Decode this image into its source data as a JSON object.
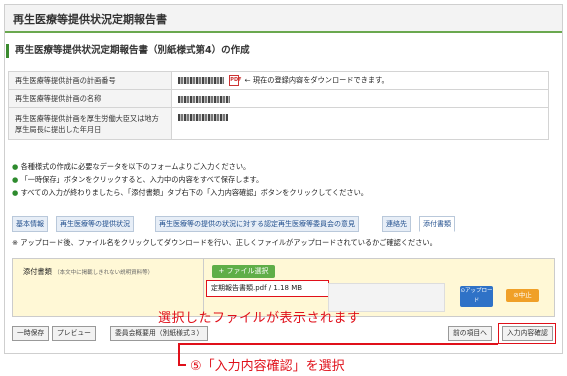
{
  "page": {
    "title": "再生医療等提供状況定期報告書",
    "section_title": "再生医療等提供状況定期報告書（別紙様式第4）の作成"
  },
  "info_table": [
    {
      "label": "再生医療等提供計画の計画番号",
      "note": "← 現在の登録内容をダウンロードできます。"
    },
    {
      "label": "再生医療等提供計画の名称",
      "note": ""
    },
    {
      "label": "再生医療等提供計画を厚生労働大臣又は地方厚生局長に提出した年月日",
      "note": ""
    }
  ],
  "notes": [
    "各種様式の作成に必要なデータを以下のフォームよりご入力ください。",
    "「一時保存」ボタンをクリックすると、入力中の内容をすべて保存します。",
    "すべての入力が終わりましたら、「添付書類」タブ右下の「入力内容確認」ボタンをクリックしてください。"
  ],
  "tabs": [
    "基本情報",
    "再生医療等の提供状況",
    "再生医療等の提供の状況に対する認定再生医療等委員会の意見",
    "連絡先",
    "添付書類"
  ],
  "upload_note": "※ アップロード後、ファイル名をクリックしてダウンロードを行い、正しくファイルがアップロードされているかご確認ください。",
  "attachment": {
    "label": "添付書類",
    "sublabel": "（本文中に掲載しきれない説明資料等）",
    "file_select_label": "+ ファイル選択",
    "file_name": "定期報告書類.pdf / 1.18 MB",
    "upload_label": "アップロード",
    "cancel_label": "中止"
  },
  "bottom_buttons": {
    "save": "一時保存",
    "preview": "プレビュー",
    "committee": "委員会概要用（別紙様式３）",
    "prev": "前の項目へ",
    "confirm": "入力内容確認"
  },
  "annotations": {
    "file_shown": "選択したファイルが表示されます",
    "step5": "⑤「入力内容確認」を選択"
  },
  "colors": {
    "accent": "#3a8a2e",
    "highlight": "#e0101a",
    "upload": "#2f72c7",
    "cancel": "#f0a028"
  }
}
